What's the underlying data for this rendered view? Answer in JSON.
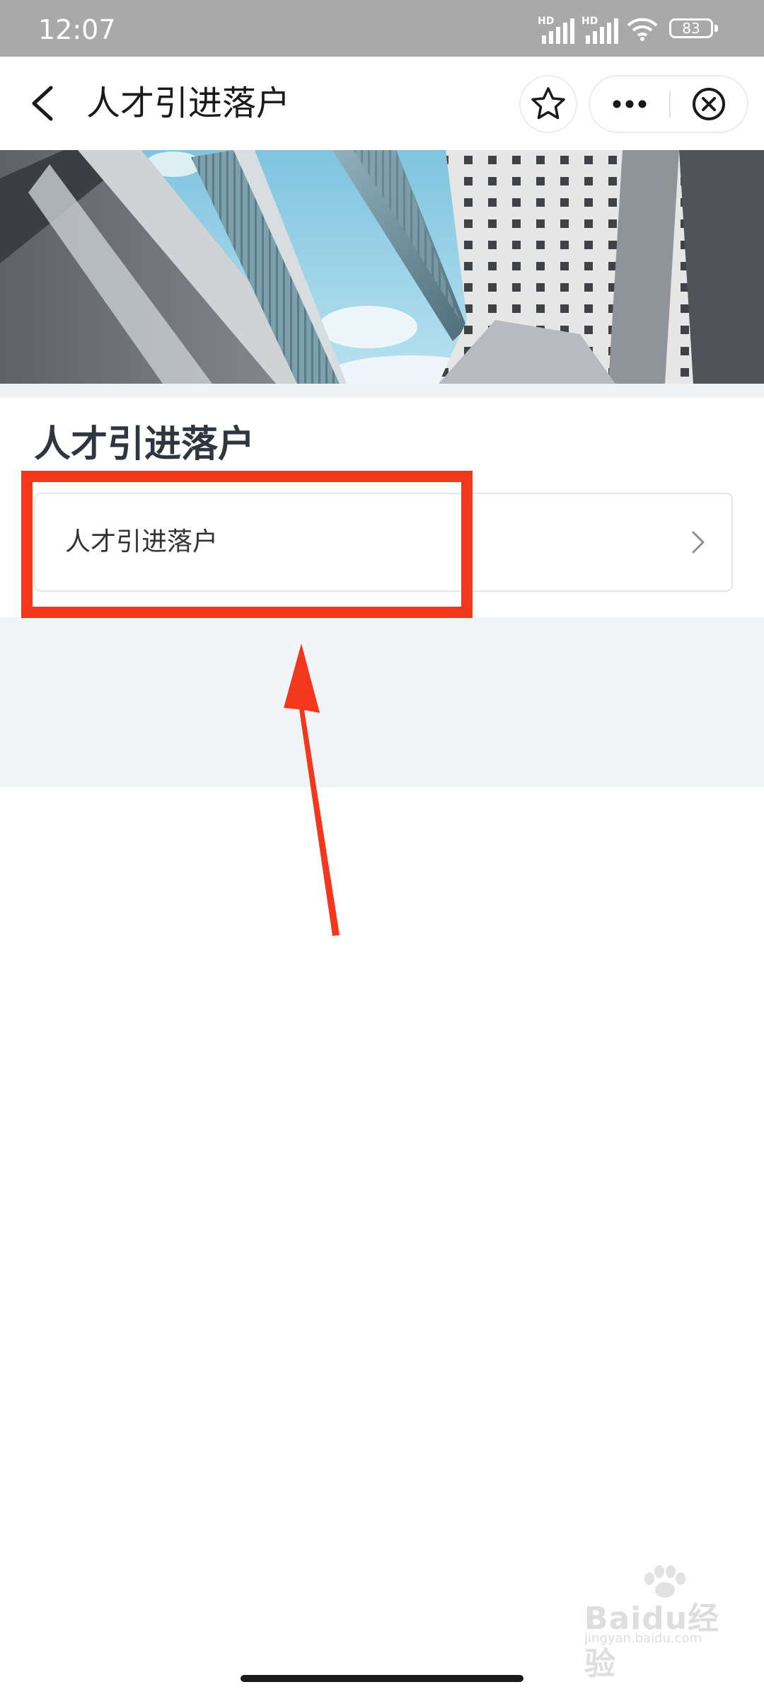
{
  "status_bar": {
    "time": "12:07",
    "signal_1_label": "HD",
    "signal_2_label": "HD",
    "battery": "83",
    "icons": [
      "signal-icon",
      "signal-icon",
      "wifi-icon",
      "battery-icon"
    ]
  },
  "nav": {
    "title": "人才引进落户",
    "icons": [
      "back-arrow-icon",
      "star-icon",
      "more-dots-icon",
      "close-circle-icon"
    ]
  },
  "banner": {
    "image": "architecture-buildings-sky-image"
  },
  "section": {
    "title": "人才引进落户",
    "items": [
      {
        "label": "人才引进落户",
        "icon": "chevron-right-icon"
      }
    ]
  },
  "annotation": {
    "highlight_color": "#f2371d",
    "arrow_color": "#f2371d"
  },
  "watermark": {
    "logo": "baidu-jingyan-logo",
    "text": "Baidu经验",
    "subtext": "jingyan.baidu.com"
  },
  "colors": {
    "status_bar": "#a9a9a9",
    "title_text": "#2f3640",
    "gray_area": "#f2f5f8"
  }
}
